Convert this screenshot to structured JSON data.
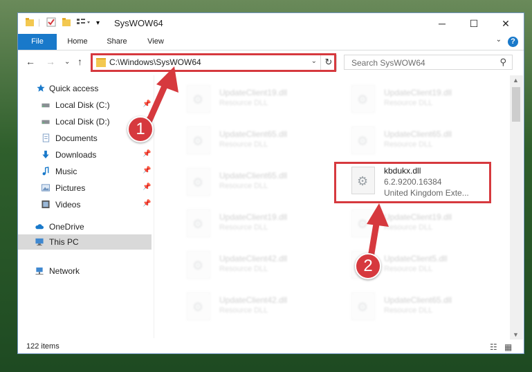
{
  "window": {
    "title": "SysWOW64"
  },
  "ribbon": {
    "tabs": [
      "File",
      "Home",
      "Share",
      "View"
    ],
    "help": "?"
  },
  "nav": {
    "address": "C:\\Windows\\SysWOW64",
    "search_placeholder": "Search SysWOW64"
  },
  "sidebar": {
    "items": [
      {
        "label": "Quick access",
        "icon": "star-icon",
        "pinned": false
      },
      {
        "label": "Local Disk (C:)",
        "icon": "drive-icon",
        "pinned": true
      },
      {
        "label": "Local Disk (D:)",
        "icon": "drive-icon",
        "pinned": true
      },
      {
        "label": "Documents",
        "icon": "documents-icon",
        "pinned": true
      },
      {
        "label": "Downloads",
        "icon": "download-icon",
        "pinned": true
      },
      {
        "label": "Music",
        "icon": "music-icon",
        "pinned": true
      },
      {
        "label": "Pictures",
        "icon": "pictures-icon",
        "pinned": true
      },
      {
        "label": "Videos",
        "icon": "videos-icon",
        "pinned": true
      },
      {
        "label": "OneDrive",
        "icon": "cloud-icon",
        "pinned": false
      },
      {
        "label": "This PC",
        "icon": "computer-icon",
        "pinned": false,
        "selected": true
      },
      {
        "label": "Network",
        "icon": "network-icon",
        "pinned": false
      }
    ]
  },
  "files": {
    "left": [
      {
        "name": "UpdateClient19.dll",
        "type": "Resource DLL"
      },
      {
        "name": "UpdateClient65.dll",
        "type": "Resource DLL"
      },
      {
        "name": "UpdateClient65.dll",
        "type": "Resource DLL"
      },
      {
        "name": "UpdateClient19.dll",
        "type": "Resource DLL"
      },
      {
        "name": "UpdateClient42.dll",
        "type": "Resource DLL"
      },
      {
        "name": "UpdateClient42.dll",
        "type": "Resource DLL"
      }
    ],
    "right": [
      {
        "name": "UpdateClient19.dll",
        "type": "Resource DLL"
      },
      {
        "name": "UpdateClient65.dll",
        "type": "Resource DLL"
      },
      {
        "name": "kbdukx.dll",
        "version": "6.2.9200.16384",
        "description": "United Kingdom Exte..."
      },
      {
        "name": "UpdateClient19.dll",
        "type": "Resource DLL"
      },
      {
        "name": "UpdateClient5.dll",
        "type": "Resource DLL"
      },
      {
        "name": "UpdateClient65.dll",
        "type": "Resource DLL"
      }
    ]
  },
  "status": {
    "count": "122 items"
  },
  "annotations": {
    "badge1": "1",
    "badge2": "2"
  },
  "colors": {
    "accent": "#1979ca",
    "highlight": "#d6393e",
    "selected": "#d9d9d9"
  }
}
